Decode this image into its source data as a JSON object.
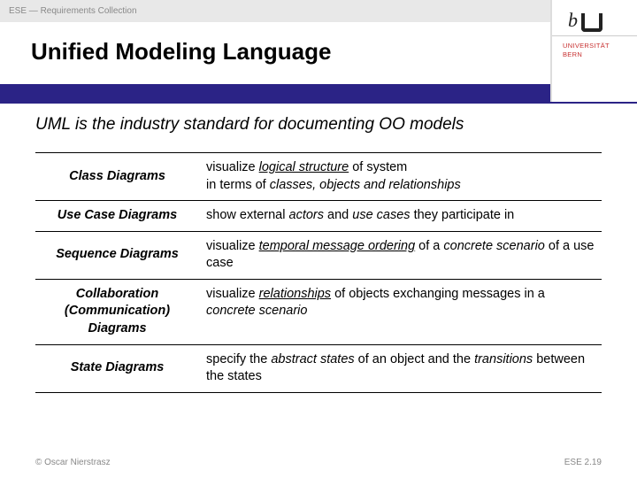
{
  "header": {
    "breadcrumb": "ESE — Requirements Collection"
  },
  "logo": {
    "name": "UNIVERSITÄT",
    "loc": "BERN"
  },
  "title": "Unified Modeling Language",
  "intro": "UML is the industry standard for documenting OO models",
  "rows": [
    {
      "label": "Class Diagrams",
      "desc_html": "visualize <span class='und'>logical structure</span> of system<br>in terms of <span class='em'>classes, objects and relationships</span>"
    },
    {
      "label": "Use Case Diagrams",
      "desc_html": "show external <span class='em'>actors</span> and <span class='em'>use cases</span> they participate in"
    },
    {
      "label": "Sequence Diagrams",
      "desc_html": "visualize <span class='und'>temporal message ordering</span> of a <span class='em'>concrete scenario</span> of a use case"
    },
    {
      "label": "Collaboration (Communication) Diagrams",
      "desc_html": "visualize <span class='und'>relationships</span> of objects exchanging messages in a <span class='em'>concrete scenario</span>"
    },
    {
      "label": "State Diagrams",
      "desc_html": "specify the <span class='em'>abstract states</span> of an object and the <span class='em'>transitions</span> between the states"
    }
  ],
  "footer": {
    "copyright": "© Oscar Nierstrasz",
    "page": "ESE 2.19"
  }
}
